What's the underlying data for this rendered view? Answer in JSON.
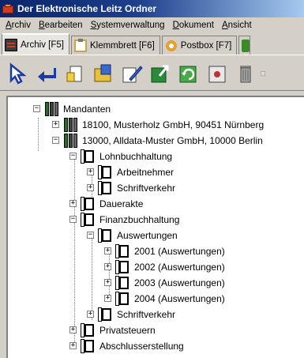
{
  "window": {
    "title": "Der Elektronische Leitz Ordner"
  },
  "menu": [
    "Archiv",
    "Bearbeiten",
    "Systemverwaltung",
    "Dokument",
    "Ansicht"
  ],
  "tabs": [
    {
      "label": "Archiv [F5]",
      "icon": "archive-icon",
      "active": true
    },
    {
      "label": "Klemmbrett [F6]",
      "icon": "clipboard-icon",
      "active": false
    },
    {
      "label": "Postbox [F7]",
      "icon": "postbox-icon",
      "active": false
    }
  ],
  "toolbar": [
    "select-arrow-icon",
    "back-arrow-icon",
    "new-document-icon",
    "folder-edit-icon",
    "edit-pen-icon",
    "export-icon",
    "refresh-icon",
    "scanner-icon",
    "delete-icon"
  ],
  "tree": {
    "root": "Mandanten",
    "n1": "18100, Musterholz GmbH, 90451 Nürnberg",
    "n2": "13000, Alldata-Muster GmbH, 10000 Berlin",
    "n2_1": "Lohnbuchhaltung",
    "n2_1_1": "Arbeitnehmer",
    "n2_1_2": "Schriftverkehr",
    "n2_2": "Dauerakte",
    "n2_3": "Finanzbuchhaltung",
    "n2_3_1": "Auswertungen",
    "n2_3_1_1": "2001 (Auswertungen)",
    "n2_3_1_2": "2002 (Auswertungen)",
    "n2_3_1_3": "2003 (Auswertungen)",
    "n2_3_1_4": "2004 (Auswertungen)",
    "n2_3_2": "Schriftverkehr",
    "n2_4": "Privatsteuern",
    "n2_5": "Abschlusserstellung"
  }
}
